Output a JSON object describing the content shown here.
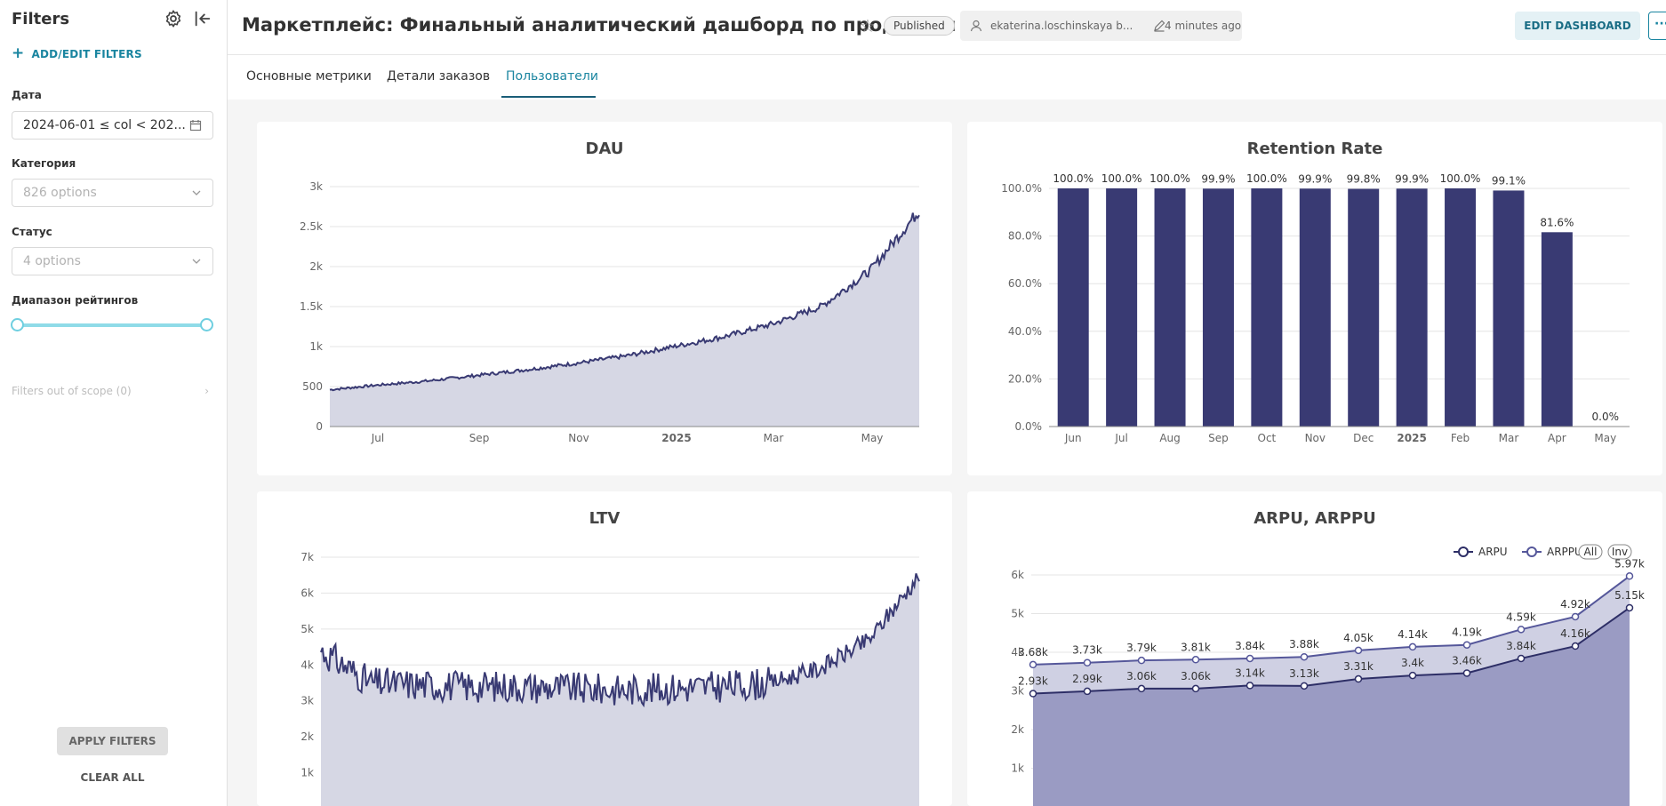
{
  "sidebar": {
    "title": "Filters",
    "add_label": "ADD/EDIT FILTERS",
    "filters": [
      {
        "label": "Дата",
        "value": "2024-06-01 ≤ col < 202...",
        "placeholder": false
      },
      {
        "label": "Категория",
        "value": "826 options",
        "placeholder": true
      },
      {
        "label": "Статус",
        "value": "4 options",
        "placeholder": true
      },
      {
        "label": "Диапазон рейтингов",
        "value": "",
        "placeholder": false
      }
    ],
    "out_of_scope": "Filters out of scope (0)",
    "apply": "APPLY FILTERS",
    "clear": "CLEAR ALL"
  },
  "header": {
    "title": "Маркетплейс: Финальный аналитический дашборд по продажам",
    "status": "Published",
    "owner": "ekaterina.loschinskaya b...",
    "modified": "4 minutes ago",
    "edit": "EDIT DASHBOARD",
    "more": "···"
  },
  "tabs": [
    {
      "label": "Основные метрики",
      "active": false
    },
    {
      "label": "Детали заказов",
      "active": false
    },
    {
      "label": "Пользователи",
      "active": true
    }
  ],
  "colors": {
    "accent": "#1a85a0",
    "series_dark": "#393a73",
    "area_light": "#d6d7e4",
    "area_arpu": "#9a9bc3"
  },
  "icons": [
    "gear-icon",
    "collapse-icon",
    "plus-icon",
    "calendar-icon",
    "chevron-down-icon",
    "chevron-right-icon",
    "star-icon",
    "user-icon",
    "pencil-icon"
  ],
  "chart_data": [
    {
      "id": "dau",
      "type": "area",
      "title": "DAU",
      "x_ticks": [
        "Jul",
        "Sep",
        "Nov",
        "2025",
        "Mar",
        "May"
      ],
      "y_ticks": [
        "0",
        "500",
        "1k",
        "1.5k",
        "2k",
        "2.5k",
        "3k"
      ],
      "ylim": [
        0,
        3000
      ],
      "x_range": [
        "2024-06-01",
        "2025-06-05"
      ],
      "grid": true,
      "series": [
        {
          "x": [
            "2024-06",
            "2024-07",
            "2024-08",
            "2024-09",
            "2024-10",
            "2024-11",
            "2024-12",
            "2025-01",
            "2025-02",
            "2025-03",
            "2025-04",
            "2025-05",
            "2025-06"
          ],
          "values": [
            460,
            520,
            570,
            640,
            710,
            790,
            880,
            1000,
            1120,
            1280,
            1500,
            1950,
            2700
          ]
        }
      ]
    },
    {
      "id": "retention",
      "type": "bar",
      "title": "Retention Rate",
      "categories": [
        "Jun",
        "Jul",
        "Aug",
        "Sep",
        "Oct",
        "Nov",
        "Dec",
        "2025",
        "Feb",
        "Mar",
        "Apr",
        "May"
      ],
      "values": [
        100.0,
        100.0,
        100.0,
        99.9,
        100.0,
        99.9,
        99.8,
        99.9,
        100.0,
        99.1,
        81.6,
        0.0
      ],
      "labels": [
        "100.0%",
        "100.0%",
        "100.0%",
        "99.9%",
        "100.0%",
        "99.9%",
        "99.8%",
        "99.9%",
        "100.0%",
        "99.1%",
        "81.6%",
        "0.0%"
      ],
      "y_ticks": [
        "0.0%",
        "20.0%",
        "40.0%",
        "60.0%",
        "80.0%",
        "100.0%"
      ],
      "ylim": [
        0,
        100
      ],
      "grid": true
    },
    {
      "id": "ltv",
      "type": "area",
      "title": "LTV",
      "x_range": [
        "2024-06-01",
        "2025-06-05"
      ],
      "y_ticks": [
        "1k",
        "2k",
        "3k",
        "4k",
        "5k",
        "6k",
        "7k"
      ],
      "ylim": [
        0,
        7000
      ],
      "grid": true,
      "series": [
        {
          "x": [
            "2024-06",
            "2024-07",
            "2024-08",
            "2024-09",
            "2024-10",
            "2024-11",
            "2024-12",
            "2025-01",
            "2025-02",
            "2025-03",
            "2025-04",
            "2025-05",
            "2025-06"
          ],
          "values": [
            4400,
            3500,
            3450,
            3400,
            3400,
            3350,
            3300,
            3350,
            3400,
            3500,
            3900,
            4700,
            6500
          ]
        }
      ]
    },
    {
      "id": "arpu",
      "type": "line",
      "title": "ARPU, ARPPU",
      "legend": {
        "items": [
          "ARPU",
          "ARPPU"
        ],
        "buttons": [
          "All",
          "Inv"
        ],
        "position": "top-right"
      },
      "y_ticks": [
        "1k",
        "2k",
        "3k",
        "4k",
        "5k",
        "6k"
      ],
      "ylim": [
        0,
        6000
      ],
      "grid": true,
      "series": [
        {
          "name": "ARPU",
          "values": [
            2930,
            2990,
            3060,
            3060,
            3140,
            3130,
            3310,
            3400,
            3460,
            3840,
            4160,
            5150
          ],
          "labels": [
            "2.93k",
            "2.99k",
            "3.06k",
            "3.06k",
            "3.14k",
            "3.13k",
            "3.31k",
            "3.4k",
            "3.46k",
            "3.84k",
            "4.16k",
            "5.15k"
          ]
        },
        {
          "name": "ARPPU",
          "values": [
            3680,
            3730,
            3790,
            3810,
            3840,
            3880,
            4050,
            4140,
            4190,
            4590,
            4920,
            5970
          ],
          "labels": [
            "3.68k",
            "3.73k",
            "3.79k",
            "3.81k",
            "3.84k",
            "3.88k",
            "4.05k",
            "4.14k",
            "4.19k",
            "4.59k",
            "4.92k",
            "5.97k"
          ]
        }
      ]
    }
  ]
}
